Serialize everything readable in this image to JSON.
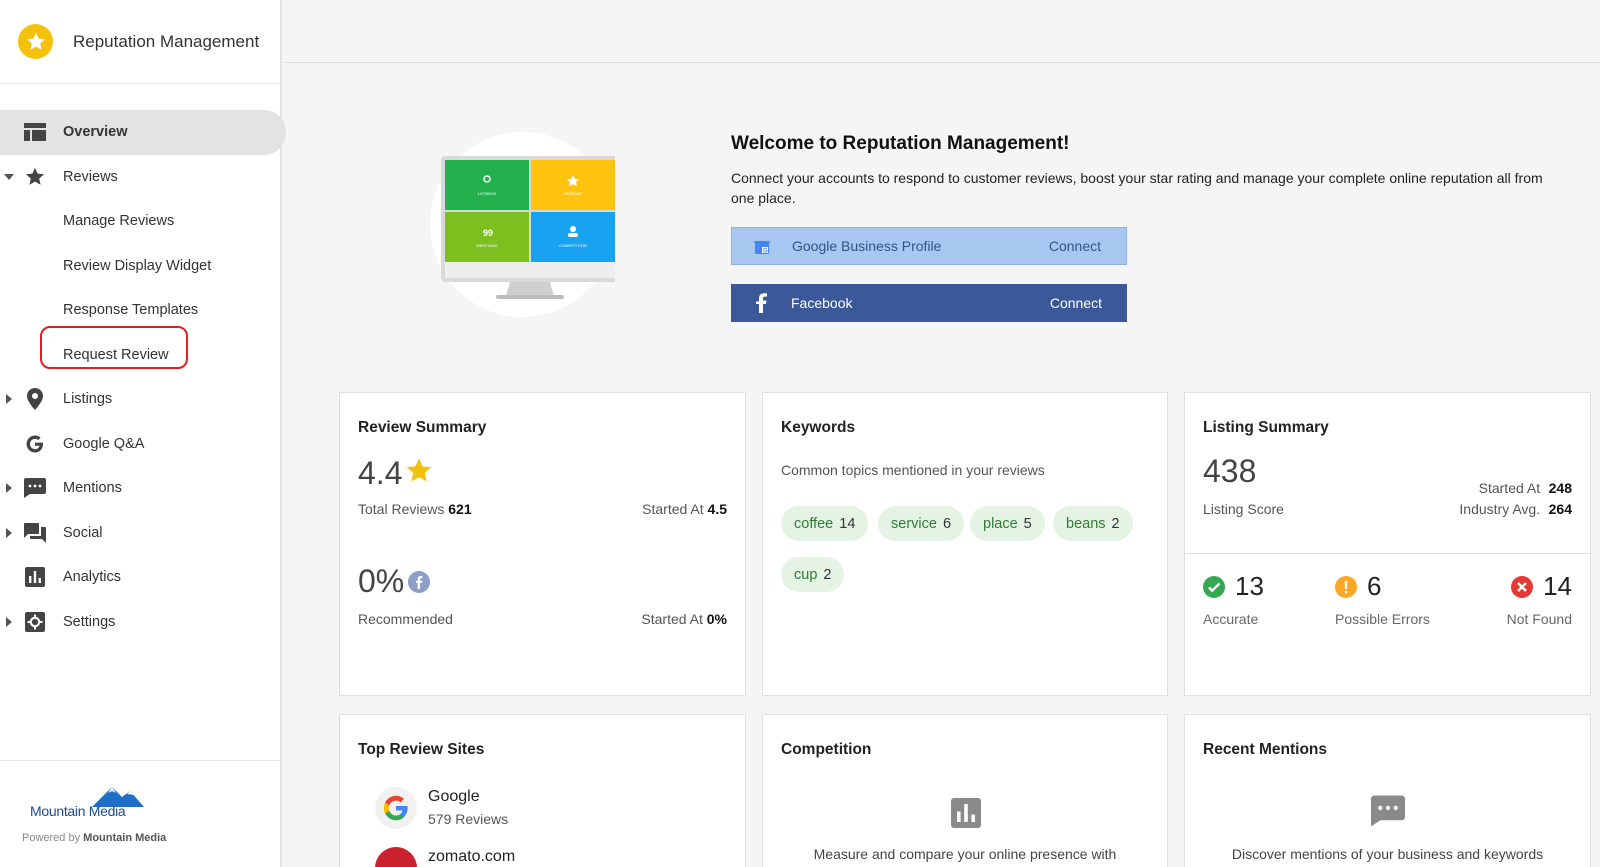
{
  "app": {
    "title": "Reputation Management"
  },
  "sidebar": {
    "items": [
      {
        "label": "Overview",
        "icon": "dashboard-icon"
      },
      {
        "label": "Reviews",
        "icon": "star-icon"
      },
      {
        "label": "Manage Reviews"
      },
      {
        "label": "Review Display Widget"
      },
      {
        "label": "Response Templates"
      },
      {
        "label": "Request Review"
      },
      {
        "label": "Listings",
        "icon": "location-pin-icon"
      },
      {
        "label": "Google Q&A",
        "icon": "google-g-icon"
      },
      {
        "label": "Mentions",
        "icon": "chat-bubble-icon"
      },
      {
        "label": "Social",
        "icon": "forum-icon"
      },
      {
        "label": "Analytics",
        "icon": "bar-chart-icon"
      },
      {
        "label": "Settings",
        "icon": "gear-icon"
      }
    ],
    "footer": {
      "logo_text": "Mountain Media",
      "powered_prefix": "Powered by",
      "powered_name": "Mountain Media"
    }
  },
  "welcome": {
    "title": "Welcome to Reputation Management!",
    "description": "Connect your accounts to respond to customer reviews, boost your star rating and manage your complete online reputation all from one place.",
    "monitor_tiles": [
      "LISTINGS",
      "REVIEWS",
      "MENTIONS",
      "COMPETITION"
    ],
    "gbp": {
      "label": "Google Business Profile",
      "action": "Connect"
    },
    "facebook": {
      "label": "Facebook",
      "action": "Connect"
    }
  },
  "review_summary": {
    "title": "Review Summary",
    "rating": "4.4",
    "total_label": "Total Reviews",
    "total_value": "621",
    "started_label": "Started At",
    "started_value": "4.5",
    "recommended_pct": "0%",
    "recommended_label": "Recommended",
    "rec_started_label": "Started At",
    "rec_started_value": "0%"
  },
  "keywords": {
    "title": "Keywords",
    "subtitle": "Common topics mentioned in your reviews",
    "chips": [
      {
        "word": "coffee",
        "count": "14"
      },
      {
        "word": "service",
        "count": "6"
      },
      {
        "word": "place",
        "count": "5"
      },
      {
        "word": "beans",
        "count": "2"
      },
      {
        "word": "cup",
        "count": "2"
      }
    ]
  },
  "listing_summary": {
    "title": "Listing Summary",
    "score": "438",
    "score_label": "Listing Score",
    "started_label": "Started At",
    "started_value": "248",
    "industry_label": "Industry Avg.",
    "industry_value": "264",
    "accurate": {
      "value": "13",
      "label": "Accurate"
    },
    "errors": {
      "value": "6",
      "label": "Possible Errors"
    },
    "not_found": {
      "value": "14",
      "label": "Not Found"
    }
  },
  "top_sites": {
    "title": "Top Review Sites",
    "sites": [
      {
        "name": "Google",
        "reviews": "579 Reviews"
      },
      {
        "name": "zomato.com"
      }
    ]
  },
  "competition": {
    "title": "Competition",
    "text": "Measure and compare your online presence with"
  },
  "recent_mentions": {
    "title": "Recent Mentions",
    "text": "Discover mentions of your business and keywords"
  },
  "colors": {
    "accent_yellow": "#f4c20d",
    "facebook_blue": "#3b5998",
    "gbp_light_blue": "#a8c7f0",
    "chip_green": "#e4f3e4",
    "ok_green": "#34a853",
    "warn_orange": "#f9a825",
    "error_red": "#e53935"
  }
}
